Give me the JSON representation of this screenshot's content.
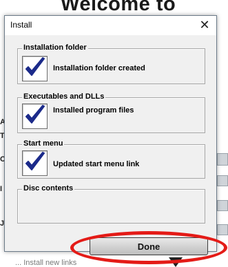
{
  "background": {
    "heading": "Welcome to",
    "bottom_text": "... Install new links"
  },
  "dialog": {
    "title": "Install",
    "close_glyph": "✕",
    "groups": [
      {
        "legend": "Installation folder",
        "status": "Installation folder created",
        "checked": true
      },
      {
        "legend": "Executables and DLLs",
        "status": "Installed program files",
        "checked": true
      },
      {
        "legend": "Start menu",
        "status": "Updated start menu link",
        "checked": true
      },
      {
        "legend": "Disc contents",
        "status": "",
        "checked": false
      }
    ],
    "done_label": "Done"
  },
  "colors": {
    "checkmark": "#1b2a8a",
    "highlight": "#e41b17"
  },
  "icons": [
    "checkmark-icon",
    "close-icon"
  ]
}
